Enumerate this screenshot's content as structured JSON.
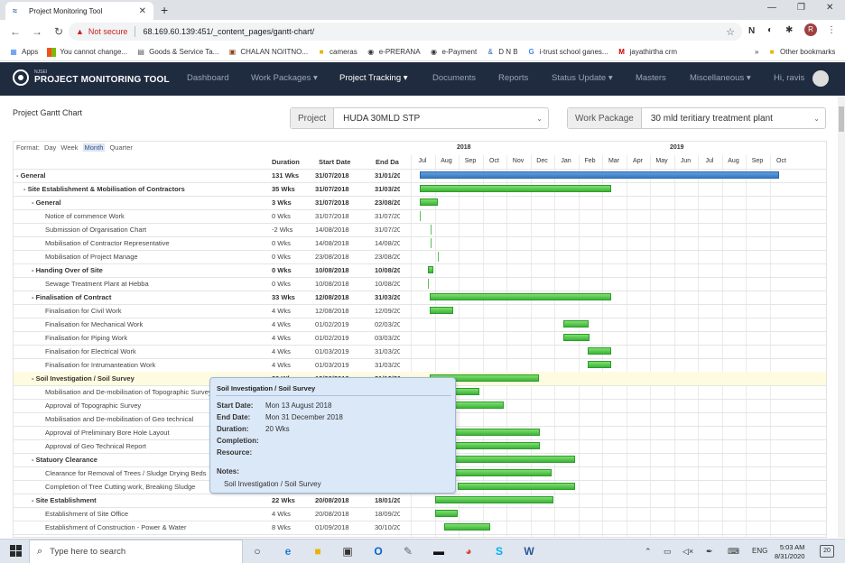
{
  "browser": {
    "tab_title": "Project Monitoring Tool",
    "not_secure": "Not secure",
    "url": "68.169.60.139:451/_content_pages/gantt-chart/",
    "bookmarks": [
      "Apps",
      "You cannot change...",
      "Goods & Service Ta...",
      "CHALAN NO/ITNO...",
      "cameras",
      "e-PRERANA",
      "e-Payment",
      "D N B",
      "i-trust school ganes...",
      "jayathirtha crm",
      "Other bookmarks"
    ],
    "profile_initial": "R"
  },
  "app": {
    "logo_small": "NJSEI",
    "logo_title": "PROJECT MONITORING TOOL",
    "nav": [
      "Dashboard",
      "Work Packages ▾",
      "Project Tracking ▾",
      "Documents",
      "Reports",
      "Status Update ▾",
      "Masters",
      "Miscellaneous ▾",
      "Hi, ravis"
    ]
  },
  "page": {
    "title": "Project Gantt Chart",
    "project_label": "Project",
    "project_value": "HUDA 30MLD STP",
    "wp_label": "Work Package",
    "wp_value": "30 mld teritiary treatment plant"
  },
  "gantt": {
    "format_label": "Format:",
    "formats": [
      "Day",
      "Week",
      "Month",
      "Quarter"
    ],
    "active_format": "Month",
    "columns": [
      "Duration",
      "Start Date",
      "End Da"
    ],
    "years": [
      "2018",
      "2019"
    ],
    "months": [
      "Jul",
      "Aug",
      "Sep",
      "Oct",
      "Nov",
      "Dec",
      "Jan",
      "Feb",
      "Mar",
      "Apr",
      "May",
      "Jun",
      "Jul",
      "Aug",
      "Sep",
      "Oct"
    ],
    "rows": [
      {
        "level": 0,
        "bold": true,
        "name": "- General",
        "dur": "131 Wks",
        "start": "31/07/2018",
        "end": "31/01/20",
        "bar": [
          0.0,
          15.0
        ],
        "color": "blue"
      },
      {
        "level": 1,
        "bold": true,
        "name": "- Site Establishment & Mobilisation of Contractors",
        "dur": "35 Wks",
        "start": "31/07/2018",
        "end": "31/03/20",
        "bar": [
          0.0,
          8.0
        ]
      },
      {
        "level": 2,
        "bold": true,
        "name": "- General",
        "dur": "3 Wks",
        "start": "31/07/2018",
        "end": "23/08/20",
        "bar": [
          0.0,
          0.75
        ]
      },
      {
        "level": 3,
        "name": "Notice of commence Work",
        "dur": "0 Wks",
        "start": "31/07/2018",
        "end": "31/07/20",
        "milestone": 0.0
      },
      {
        "level": 3,
        "name": "Submission of Organisation Chart",
        "dur": "-2 Wks",
        "start": "14/08/2018",
        "end": "31/07/20",
        "milestone": 0.45
      },
      {
        "level": 3,
        "name": "Mobilisation of Contractor Representative",
        "dur": "0 Wks",
        "start": "14/08/2018",
        "end": "14/08/20",
        "milestone": 0.45
      },
      {
        "level": 3,
        "name": "Mobilisation of Project Manage",
        "dur": "0 Wks",
        "start": "23/08/2018",
        "end": "23/08/20",
        "milestone": 0.75
      },
      {
        "level": 2,
        "bold": true,
        "name": "- Handing Over of Site",
        "dur": "0 Wks",
        "start": "10/08/2018",
        "end": "10/08/20",
        "bar": [
          0.33,
          0.55
        ]
      },
      {
        "level": 3,
        "name": "Sewage Treatment Plant at Hebba",
        "dur": "0 Wks",
        "start": "10/08/2018",
        "end": "10/08/20",
        "milestone": 0.33
      },
      {
        "level": 2,
        "bold": true,
        "name": "- Finalisation of Contract",
        "dur": "33 Wks",
        "start": "12/08/2018",
        "end": "31/03/20",
        "bar": [
          0.4,
          8.0
        ]
      },
      {
        "level": 3,
        "name": "Finalisation for Civil Work",
        "dur": "4 Wks",
        "start": "12/08/2018",
        "end": "12/09/20",
        "bar": [
          0.4,
          1.4
        ]
      },
      {
        "level": 3,
        "name": "Finalisation for Mechanical Work",
        "dur": "4 Wks",
        "start": "01/02/2019",
        "end": "02/03/20",
        "bar": [
          6.0,
          7.05
        ]
      },
      {
        "level": 3,
        "name": "Finalisation for Piping Work",
        "dur": "4 Wks",
        "start": "01/02/2019",
        "end": "03/03/20",
        "bar": [
          6.0,
          7.1
        ]
      },
      {
        "level": 3,
        "name": "Finalisation for Electrical Work",
        "dur": "4 Wks",
        "start": "01/03/2019",
        "end": "31/03/20",
        "bar": [
          7.0,
          8.0
        ]
      },
      {
        "level": 3,
        "name": "Finalisation for Intrumanteation Work",
        "dur": "4 Wks",
        "start": "01/03/2019",
        "end": "31/03/20",
        "bar": [
          7.0,
          8.0
        ]
      },
      {
        "level": 2,
        "bold": true,
        "highlight": true,
        "name": "- Soil Investigation / Soil Survey",
        "dur": "20 Wks",
        "start": "13/08/2018",
        "end": "31/12/20",
        "bar": [
          0.43,
          5.0
        ]
      },
      {
        "level": 3,
        "name": "Mobilisation and De-mobilisation of Topographic Survey",
        "dur": "",
        "start": "",
        "end": "",
        "bar": [
          1.0,
          2.5
        ]
      },
      {
        "level": 3,
        "name": "Approval of Topographic Survey",
        "dur": "",
        "start": "",
        "end": "",
        "bar": [
          1.0,
          3.5
        ]
      },
      {
        "level": 3,
        "name": "Mobilisation and De-mobilisation of Geo technical",
        "dur": "",
        "start": "",
        "end": "",
        "bar": [
          1.0,
          1.35
        ]
      },
      {
        "level": 3,
        "name": "Approval of Preliminary Bore Hole Layout",
        "dur": "",
        "start": "",
        "end": "",
        "bar": [
          1.0,
          5.0
        ]
      },
      {
        "level": 3,
        "name": "Approval of Geo Technical Report",
        "dur": "",
        "start": "",
        "end": "",
        "bar": [
          1.0,
          5.0
        ]
      },
      {
        "level": 2,
        "bold": true,
        "name": "- Statuory Clearance",
        "dur": "",
        "start": "",
        "end": "",
        "bar": [
          1.0,
          6.5
        ]
      },
      {
        "level": 3,
        "name": "Clearance for Removal of Trees / Sludge Drying Beds",
        "dur": "",
        "start": "",
        "end": "",
        "bar": [
          1.0,
          5.5
        ]
      },
      {
        "level": 3,
        "name": "Completion of Tree Cutting work, Breaking Sludge",
        "dur": "",
        "start": "",
        "end": "",
        "bar": [
          1.6,
          6.5
        ]
      },
      {
        "level": 2,
        "bold": true,
        "name": "- Site Establishment",
        "dur": "22 Wks",
        "start": "20/08/2018",
        "end": "18/01/20",
        "bar": [
          0.65,
          5.6
        ]
      },
      {
        "level": 3,
        "name": "Establishment of Site Office",
        "dur": "4 Wks",
        "start": "20/08/2018",
        "end": "18/09/20",
        "bar": [
          0.65,
          1.6
        ]
      },
      {
        "level": 3,
        "name": "Establishment of Construction - Power & Water",
        "dur": "8 Wks",
        "start": "01/09/2018",
        "end": "30/10/20",
        "bar": [
          1.0,
          2.95
        ]
      }
    ]
  },
  "tooltip": {
    "title": "Soil Investigation / Soil Survey",
    "start_label": "Start Date:",
    "start_value": "Mon 13 August 2018",
    "end_label": "End Date:",
    "end_value": "Mon 31 December 2018",
    "duration_label": "Duration:",
    "duration_value": "20 Wks",
    "completion_label": "Completion:",
    "resource_label": "Resource:",
    "notes_label": "Notes:",
    "notes_value": "Soil Investigation / Soil Survey"
  },
  "taskbar": {
    "search_placeholder": "Type here to search",
    "lang": "ENG",
    "time": "5:03 AM",
    "date": "8/31/2020",
    "notif_count": "20"
  },
  "colors": {
    "nav_bg": "#1f2b3e",
    "bar_green": "#3cb43a",
    "bar_blue": "#3679bf",
    "tooltip_bg": "#dbe8f7"
  }
}
